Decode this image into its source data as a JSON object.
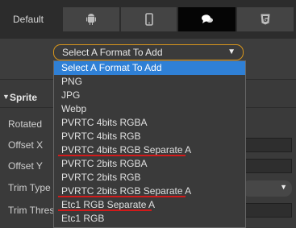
{
  "tabs": {
    "default_label": "Default",
    "icons": [
      "android-icon",
      "mobile-phone-icon",
      "chat-bubbles-icon",
      "html5-icon"
    ],
    "active_index": 2
  },
  "format_select": {
    "value": "Select A Format To Add",
    "options": [
      "Select A Format To Add",
      "PNG",
      "JPG",
      "Webp",
      "PVRTC 4bits RGBA",
      "PVRTC 4bits RGB",
      "PVRTC 4bits RGB Separate A",
      "PVRTC 2bits RGBA",
      "PVRTC 2bits RGB",
      "PVRTC 2bits RGB Separate A",
      "Etc1 RGB Separate A",
      "Etc1 RGB"
    ],
    "highlighted_index": 0,
    "underlined_indices": [
      6,
      9,
      10
    ],
    "underline_color": "#d21a1a",
    "highlight_color": "#2f80d6",
    "border_color": "#d8961c"
  },
  "sprite": {
    "title": "Sprite",
    "props": {
      "rotated": "Rotated",
      "offset_x": "Offset X",
      "offset_y": "Offset Y",
      "trim_type": "Trim Type",
      "trim_threshold": "Trim Thres"
    }
  }
}
